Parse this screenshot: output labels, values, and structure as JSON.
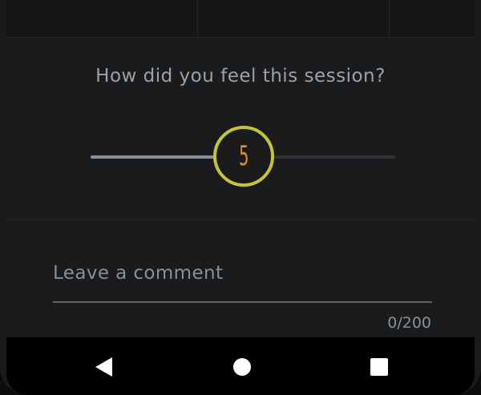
{
  "feedback": {
    "question": "How did you feel this session?",
    "rating": {
      "min": 0,
      "max": 10,
      "value": 5,
      "label": "5"
    }
  },
  "comment": {
    "placeholder": "Leave a comment",
    "value": "",
    "counter": "0/200"
  },
  "colors": {
    "thumb_ring": "#c5c33a",
    "thumb_value": "#e08a28",
    "track_fill": "#8a9196",
    "track_rest": "#2e3033"
  },
  "navbar": {
    "icons": [
      "back-triangle-icon",
      "home-circle-icon",
      "recents-square-icon"
    ]
  }
}
